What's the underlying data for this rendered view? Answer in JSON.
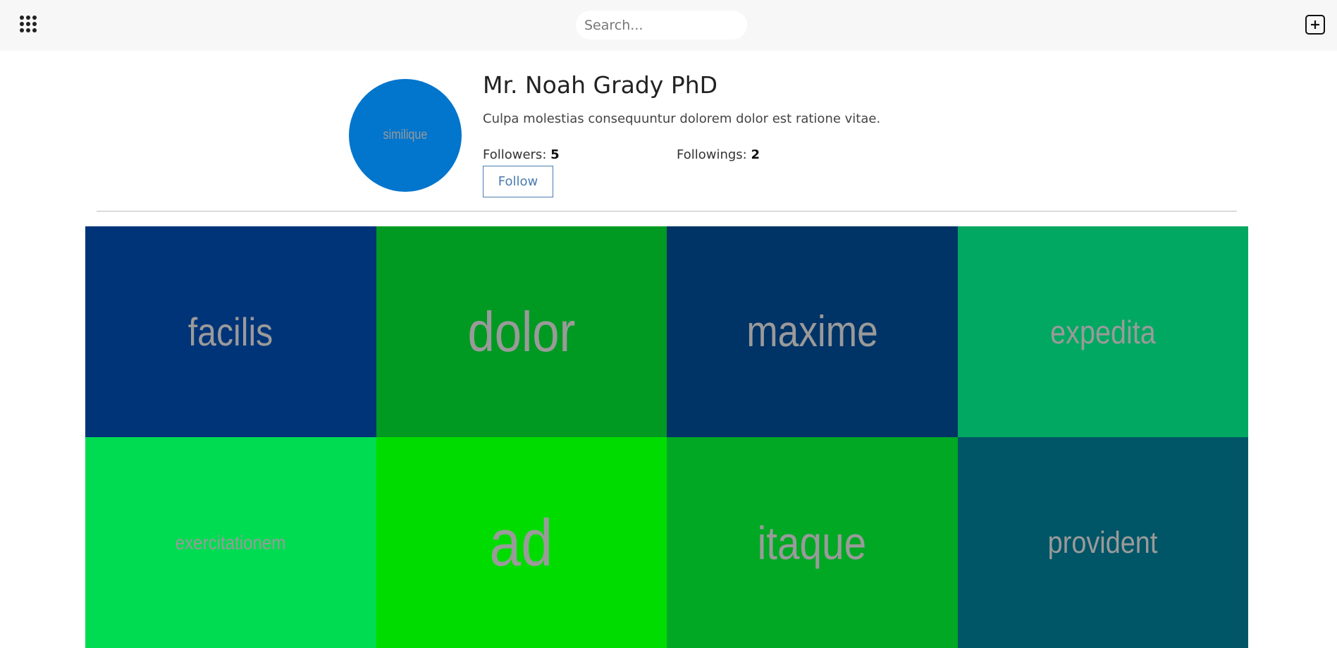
{
  "header": {
    "menu_icon": "apps-grid-icon",
    "search_placeholder": "Search...",
    "add_icon": "plus-square-icon"
  },
  "profile": {
    "avatar_label": "similique",
    "avatar_color": "#0275cc",
    "name": "Mr. Noah Grady PhD",
    "bio": "Culpa molestias consequuntur dolorem dolor est ratione vitae.",
    "followers_label": "Followers:",
    "followers_count": "5",
    "followings_label": "Followings:",
    "followings_count": "2",
    "follow_button": "Follow"
  },
  "posts": [
    {
      "label": "facilis",
      "color": "#003478"
    },
    {
      "label": "dolor",
      "color": "#009a22"
    },
    {
      "label": "maxime",
      "color": "#003366"
    },
    {
      "label": "expedita",
      "color": "#00a862"
    },
    {
      "label": "exercitationem",
      "color": "#00dc52"
    },
    {
      "label": "ad",
      "color": "#00dc00"
    },
    {
      "label": "itaque",
      "color": "#00a824"
    },
    {
      "label": "provident",
      "color": "#005566"
    }
  ]
}
